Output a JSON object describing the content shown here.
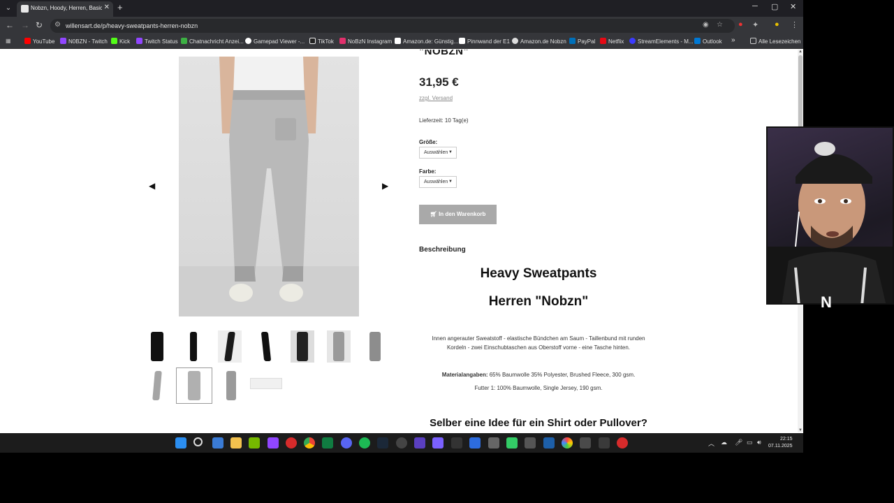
{
  "browser": {
    "tab_title": "Nobzn, Hoody, Herren, Basic, M",
    "tab_close": "✕",
    "new_tab": "+",
    "url": "willensart.de/p/heavy-sweatpants-herren-nobzn",
    "window_controls": [
      "─",
      "▢",
      "✕"
    ]
  },
  "bookmarks": [
    {
      "label": "YouTube",
      "color": "#ff0000"
    },
    {
      "label": "N0BZN - Twitch",
      "color": "#9146ff"
    },
    {
      "label": "Kick",
      "color": "#53fc18"
    },
    {
      "label": "Twitch Status",
      "color": "#9146ff"
    },
    {
      "label": "Chatnachricht Anzei...",
      "color": "#3cb043"
    },
    {
      "label": "Gamepad Viewer -...",
      "color": "#ffffff"
    },
    {
      "label": "TikTok",
      "color": "#ffffff"
    },
    {
      "label": "NoBzN Instagram",
      "color": "#e1306c"
    },
    {
      "label": "Amazon.de: Günstig...",
      "color": "#ffffff"
    },
    {
      "label": "Pinnwand der E1",
      "color": "#ffffff"
    },
    {
      "label": "Amazon.de Nobzn",
      "color": "#ffffff"
    },
    {
      "label": "PayPal",
      "color": "#0070ba"
    },
    {
      "label": "Netflix",
      "color": "#e50914"
    },
    {
      "label": "StreamElements - M...",
      "color": "#3b3bff"
    },
    {
      "label": "Outlook",
      "color": "#0078d4"
    }
  ],
  "bookmarks_more": "»",
  "bookmarks_all": "Alle Lesezeichen",
  "product": {
    "cut_title": "\"NOBZN\"",
    "price": "31,95 €",
    "shipping": "zzgl. Versand",
    "delivery": "Lieferzeit: 10 Tag(e)",
    "size_label": "Größe:",
    "size_value": "Auswählen",
    "color_label": "Farbe:",
    "color_value": "Auswählen",
    "cart_button": "In den Warenkorb",
    "description_heading": "Beschreibung",
    "heading1": "Heavy Sweatpants",
    "heading2": "Herren \"Nobzn\"",
    "desc_text": "Innen angerauter Sweatstoff - elastische Bündchen am Saum - Taillenbund mit runden Kordeln - zwei Einschubtaschen aus Oberstoff vorne - eine Tasche hinten.",
    "material_label": "Materialangaben:",
    "material_text": "65% Baumwolle 35% Polyester, Brushed Fleece, 300 gsm.",
    "lining_text": "Futter 1: 100% Baumwolle, Single Jersey, 190 gsm.",
    "idea_heading": "Selber eine Idee für ein Shirt oder Pullover?"
  },
  "gallery": {
    "prev": "◀",
    "next": "▶",
    "thumbnail_colors": [
      "#111111",
      "#111111",
      "#1a1a1a",
      "#111111",
      "#222222",
      "#9a9a9a",
      "#8d8d8d",
      "#a5a5a5",
      "#b0b0b0",
      "#9a9a9a",
      "#f0f0f0"
    ]
  },
  "taskbar": {
    "time": "22:15",
    "date": "07.11.2025"
  }
}
